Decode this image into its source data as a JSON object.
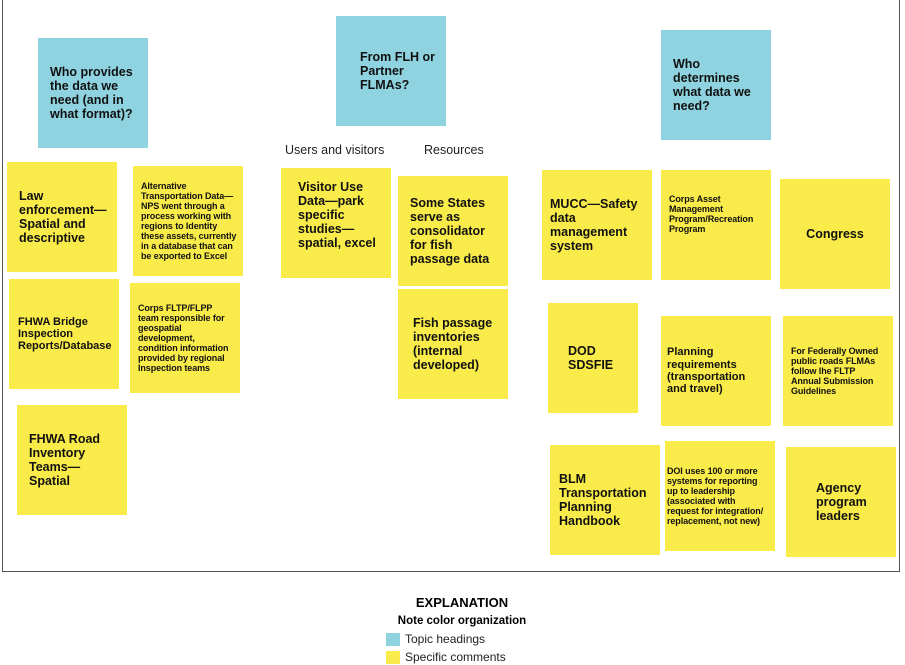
{
  "topics": [
    {
      "text": "Who provides the data we need (and in what format)?"
    },
    {
      "text": "From FLH or Partner FLMAs?"
    },
    {
      "text": "Who determines what data we need?"
    }
  ],
  "column_labels": [
    "Users and visitors",
    "Resources"
  ],
  "notes": [
    "Law enforcement—Spatial and descriptive",
    "Alternative Transportation Data—NPS went through a process working with regions to Identity these assets, currently in a database that can be exported to Excel",
    "FHWA Bridge Inspection Reports/Database",
    "Corps FLTP/FLPP team responsible for geospatial development, condition information provided by regional Inspection teams",
    "FHWA Road Inventory Teams—Spatial",
    "Visitor Use Data—park specific studies—spatial, excel",
    "Some States serve as consolidator for fish passage data",
    "Fish passage inventories (internal developed)",
    "MUCC—Safety data management system",
    "Corps Asset Management Program/Recreation Program",
    "Congress",
    "DOD SDSFIE",
    "Planning requirements (transportation and travel)",
    "For Federally Owned public roads FLMAs follow lhe FLTP Annual Submission Guidelines",
    "BLM Transportation Planning Handbook",
    "DOI uses 100 or more systems for reporting up to leadership (associated with request for integration/ replacement, not new)",
    "Agency program leaders"
  ],
  "legend": {
    "title": "EXPLANATION",
    "subtitle": "Note color organization",
    "items": [
      {
        "label": "Topic headings",
        "color": "#8fd3e1"
      },
      {
        "label": "Specific comments",
        "color": "#f9eb49"
      }
    ]
  }
}
